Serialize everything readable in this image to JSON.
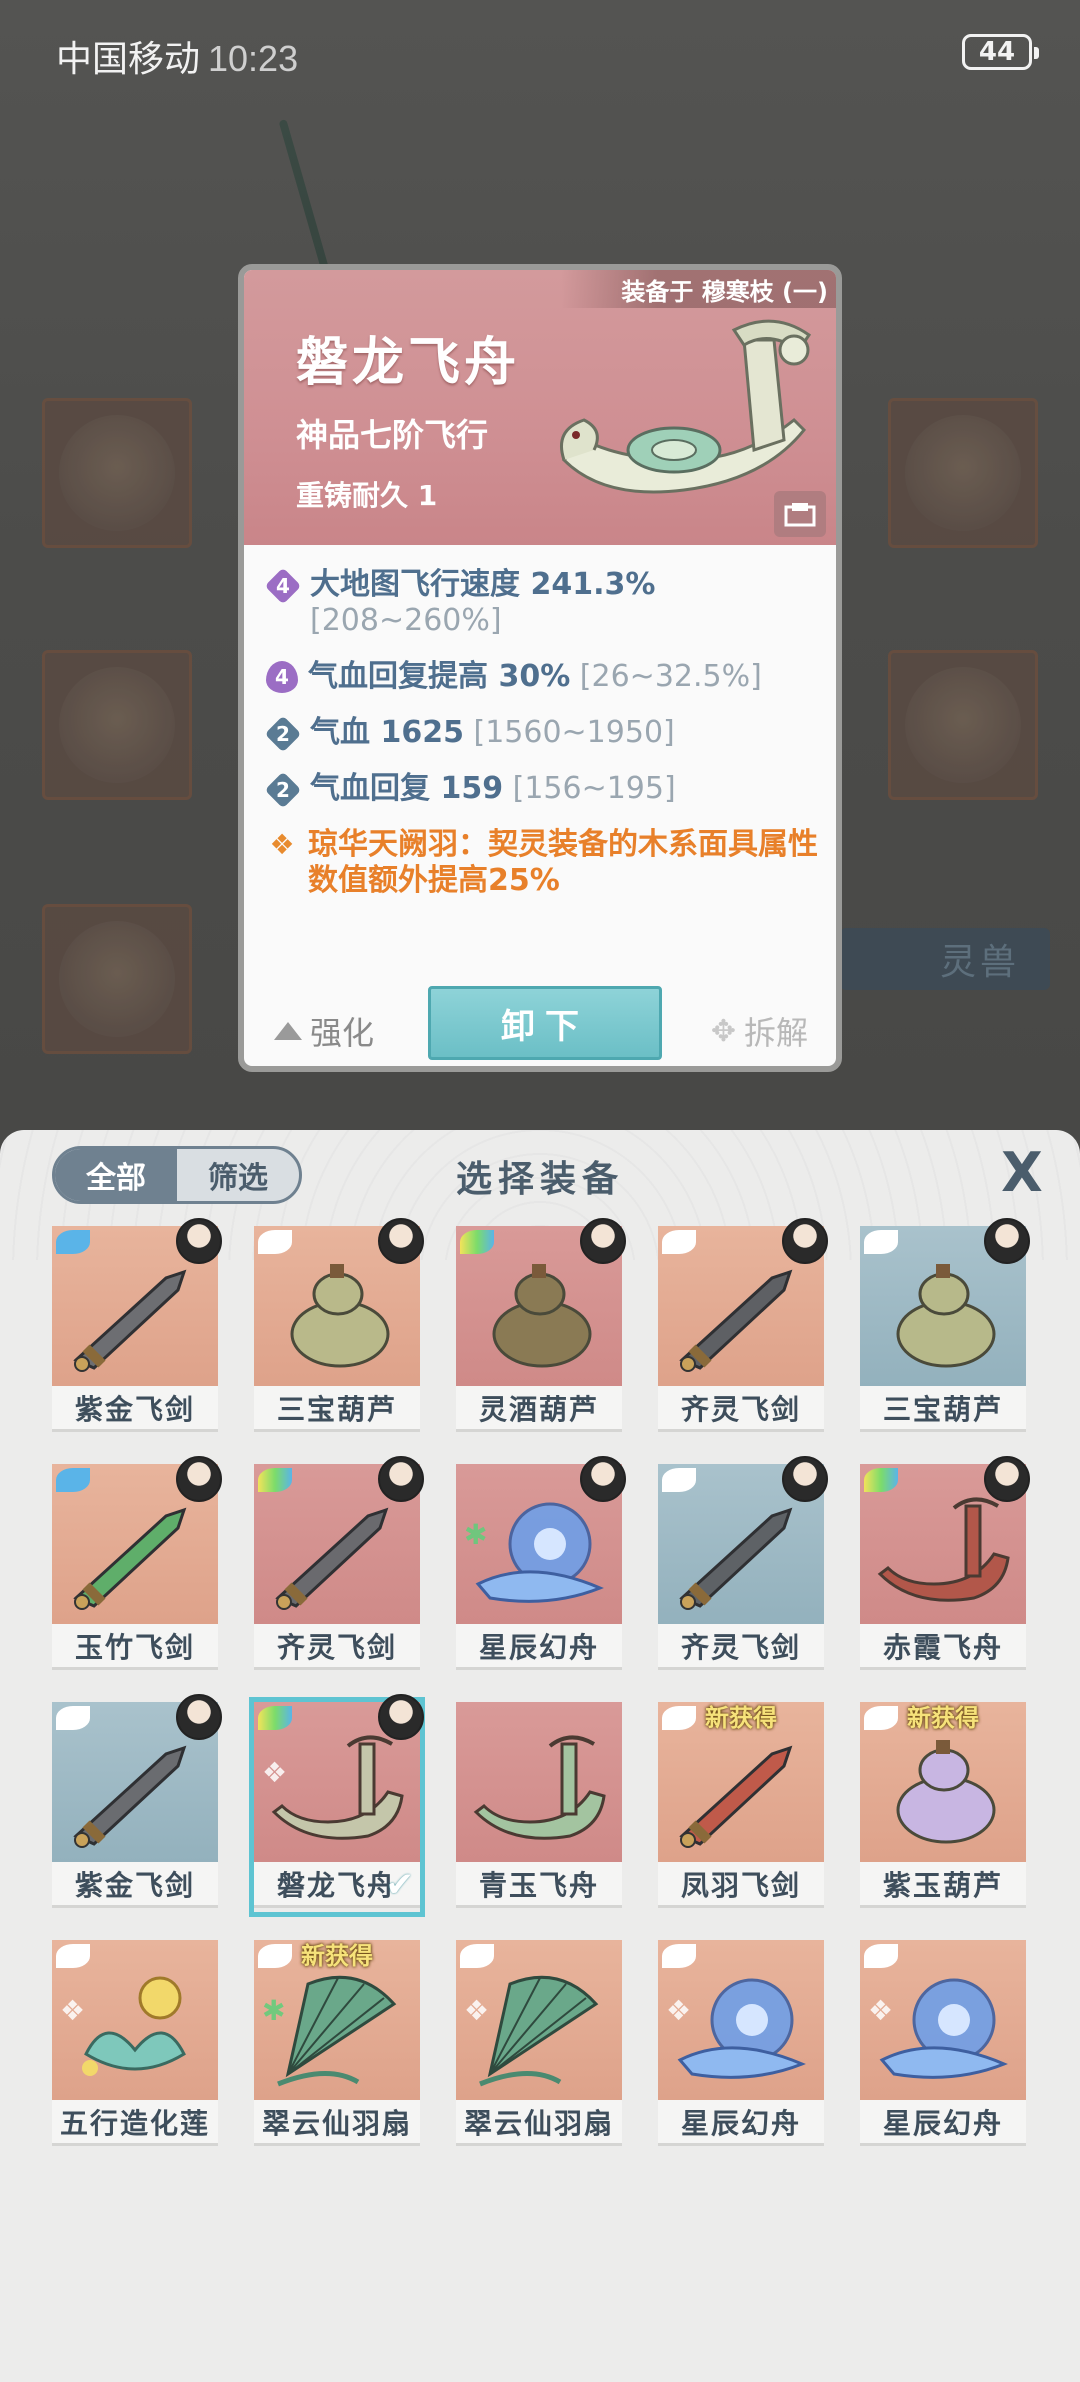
{
  "status_bar": {
    "carrier": "中国移动",
    "time": "10:23",
    "battery": "44"
  },
  "background": {
    "side_tab": "灵兽"
  },
  "detail": {
    "equipped_on": "装备于 穆寒枝 (一)",
    "name": "磐龙飞舟",
    "grade": "神品七阶飞行",
    "durability": "重铸耐久 1",
    "stats": [
      {
        "badge": "4",
        "main": "大地图飞行速度 241.3%",
        "range": " [208~260%]"
      },
      {
        "badge": "4",
        "main": "气血回复提高 30%",
        "range": " [26~32.5%]"
      },
      {
        "badge": "2",
        "main": "气血 1625",
        "range": " [1560~1950]"
      },
      {
        "badge": "2",
        "main": "气血回复 159",
        "range": " [156~195]"
      }
    ],
    "special": "琼华天阙羽：契灵装备的木系面具属性数值额外提高25%",
    "actions": {
      "enhance": "强化",
      "unequip": "卸下",
      "dismantle": "拆解"
    }
  },
  "panel": {
    "filter_all": "全部",
    "filter_screen": "筛选",
    "title": "选择装备",
    "close": "X",
    "new_tag": "新获得",
    "items": [
      {
        "name": "紫金飞剑",
        "bg": "orange",
        "wing": "blue",
        "avatar": true,
        "art": "sword",
        "art_color": "#6d6e72"
      },
      {
        "name": "三宝葫芦",
        "bg": "orange",
        "wing": "white",
        "avatar": true,
        "art": "gourd",
        "art_color": "#b9b98a"
      },
      {
        "name": "灵酒葫芦",
        "bg": "red",
        "wing": "rainbow",
        "avatar": true,
        "art": "gourd",
        "art_color": "#8a7a54"
      },
      {
        "name": "齐灵飞剑",
        "bg": "orange",
        "wing": "white",
        "avatar": true,
        "art": "sword",
        "art_color": "#5e6064"
      },
      {
        "name": "三宝葫芦",
        "bg": "blue",
        "wing": "white",
        "avatar": true,
        "art": "gourd",
        "art_color": "#b7b98a"
      },
      {
        "name": "玉竹飞剑",
        "bg": "orange",
        "wing": "blue",
        "avatar": true,
        "art": "sword",
        "art_color": "#5fae6a"
      },
      {
        "name": "齐灵飞剑",
        "bg": "red",
        "wing": "rainbow",
        "avatar": true,
        "art": "sword",
        "art_color": "#6a6a6e"
      },
      {
        "name": "星辰幻舟",
        "bg": "red",
        "wing": "",
        "avatar": true,
        "art": "orb",
        "art_color": "#6f9fe8",
        "elem": "✱",
        "elem_color": "green"
      },
      {
        "name": "齐灵飞剑",
        "bg": "blue",
        "wing": "white",
        "avatar": true,
        "art": "sword",
        "art_color": "#5e6266"
      },
      {
        "name": "赤霞飞舟",
        "bg": "red",
        "wing": "rainbow",
        "avatar": true,
        "art": "boat",
        "art_color": "#b2574a"
      },
      {
        "name": "紫金飞剑",
        "bg": "blue",
        "wing": "white",
        "avatar": true,
        "art": "sword",
        "art_color": "#6a6c70"
      },
      {
        "name": "磐龙飞舟",
        "bg": "red",
        "wing": "rainbow",
        "avatar": true,
        "art": "boat",
        "art_color": "#c4c6aa",
        "elem": "❖",
        "selected": true
      },
      {
        "name": "青玉飞舟",
        "bg": "red",
        "wing": "",
        "avatar": false,
        "art": "boat",
        "art_color": "#a3c4a0"
      },
      {
        "name": "凤羽飞剑",
        "bg": "orange",
        "wing": "white",
        "avatar": false,
        "art": "sword",
        "art_color": "#c05a4a",
        "new": true
      },
      {
        "name": "紫玉葫芦",
        "bg": "orange",
        "wing": "white",
        "avatar": false,
        "art": "gourd",
        "art_color": "#c8b6e2",
        "new": true
      },
      {
        "name": "五行造化莲",
        "bg": "orange",
        "wing": "white",
        "avatar": false,
        "art": "lotus",
        "art_color": "#7ec8bb",
        "elem": "❖"
      },
      {
        "name": "翠云仙羽扇",
        "bg": "orange",
        "wing": "white",
        "avatar": false,
        "art": "fan",
        "art_color": "#6aa88a",
        "elem": "✱",
        "elem_color": "green",
        "new": true
      },
      {
        "name": "翠云仙羽扇",
        "bg": "orange",
        "wing": "white",
        "avatar": false,
        "art": "fan",
        "art_color": "#6aa88a",
        "elem": "❖"
      },
      {
        "name": "星辰幻舟",
        "bg": "orange",
        "wing": "white",
        "avatar": false,
        "art": "orb",
        "art_color": "#6f9fe8",
        "elem": "❖"
      },
      {
        "name": "星辰幻舟",
        "bg": "orange",
        "wing": "white",
        "avatar": false,
        "art": "orb",
        "art_color": "#6f9fe8",
        "elem": "❖"
      }
    ]
  }
}
